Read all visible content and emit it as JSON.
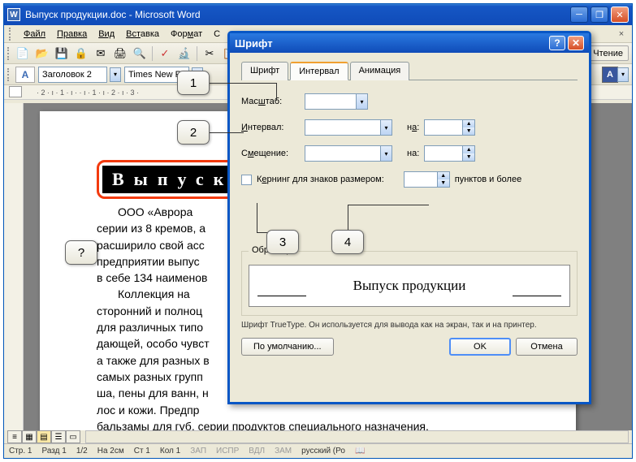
{
  "window": {
    "title": "Выпуск продукции.doc - Microsoft Word",
    "icon_letter": "W"
  },
  "menubar": {
    "file": "Файл",
    "edit": "Правка",
    "view": "Вид",
    "insert": "Вставка",
    "format": "Формат",
    "tools_initial": "С"
  },
  "toolbar": {
    "read_label": "Чтение"
  },
  "formatting": {
    "style": "Заголовок 2",
    "font": "Times New R",
    "aa": "A",
    "color_letter": "A"
  },
  "ruler_text": "· 2 · ı · 1 · ı ·    · ı · 1 · ı · 2 · ı · 3 ·",
  "document": {
    "heading": "Выпуск",
    "para1": "ООО «Аврора",
    "para2": "серии из 8 кремов, а",
    "para3": "расширило свой асс",
    "para4": "предприятии выпус",
    "para5": "в себе 134 наименов",
    "para6": "Коллекция на",
    "para7": "сторонний и полноц",
    "para8": "для различных типо",
    "para9": "дающей, особо чувст",
    "para10": "а также для разных в",
    "para11": "самых разных групп",
    "para12": "ша, пены для ванн, н",
    "para13": "лос и кожи. Предпр",
    "para14": "бальзамы для губ, серии продуктов специального назначения."
  },
  "statusbar": {
    "page": "Стр. 1",
    "section": "Разд 1",
    "pages": "1/2",
    "at": "На 2см",
    "line": "Ст 1",
    "col": "Кол 1",
    "rec": "ЗАП",
    "fix": "ИСПР",
    "ext": "ВДЛ",
    "ovr": "ЗАМ",
    "lang": "русский (Ро"
  },
  "dialog": {
    "title": "Шрифт",
    "tabs": {
      "font": "Шрифт",
      "spacing": "Интервал",
      "animation": "Анимация"
    },
    "labels": {
      "scale": "Масштаб:",
      "spacing": "Интервал:",
      "position": "Смещение:",
      "by": "на:",
      "kerning": "Кернинг для знаков размером:",
      "kerning_suffix": "пунктов и более",
      "sample_legend": "Образец",
      "sample_text": "Выпуск продукции",
      "sample_note": "Шрифт TrueType. Он используется для вывода как на экран, так и на принтер."
    },
    "buttons": {
      "default": "По умолчанию...",
      "ok": "OK",
      "cancel": "Отмена"
    }
  },
  "callouts": {
    "c1": "1",
    "c2": "2",
    "c3": "3",
    "c4": "4",
    "cq": "?"
  }
}
